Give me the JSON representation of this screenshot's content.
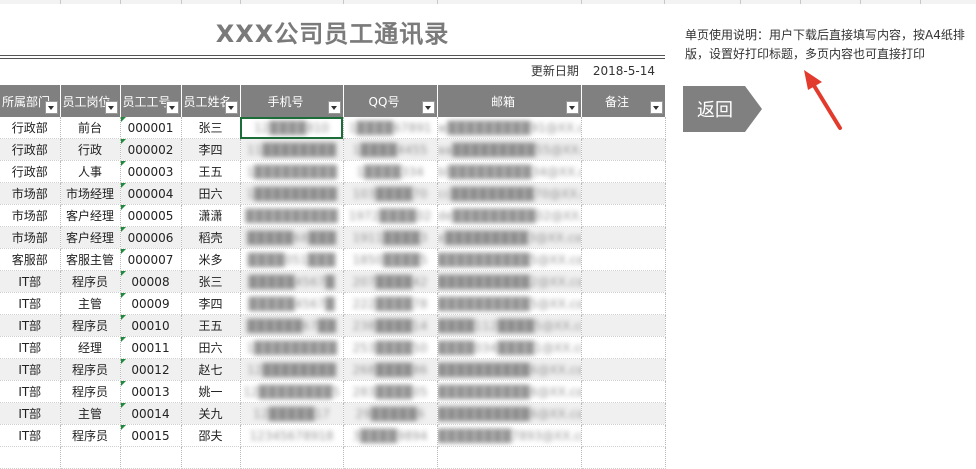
{
  "title": "XXX公司员工通讯录",
  "update_label": "更新日期",
  "update_date": "2018-5-14",
  "usage_note": "单页使用说明：用户下载后直接填写内容，按A4纸排版，设置好打印标题，多页内容也可直接打印",
  "back_button": "返回",
  "headers": [
    "所属部门",
    "员工岗位",
    "员工工号",
    "员工姓名",
    "手机号",
    "QQ号",
    "邮箱",
    "备注"
  ],
  "rows": [
    {
      "dept": "行政部",
      "post": "前台",
      "id": "000001",
      "name": "张三",
      "phone": "12████810",
      "qq": "1████67891",
      "email": "w█████████91@XX.com",
      "note": ""
    },
    {
      "dept": "行政部",
      "post": "行政",
      "id": "000002",
      "name": "李四",
      "phone": "11████████",
      "qq": "1████4455",
      "email": "aa█████████55@XX.com",
      "note": ""
    },
    {
      "dept": "行政部",
      "post": "人事",
      "id": "000003",
      "name": "王五",
      "phone": "1█████████",
      "qq": "1████334",
      "email": "bl█████████34@XX.com",
      "note": ""
    },
    {
      "dept": "市场部",
      "post": "市场经理",
      "id": "000004",
      "name": "田六",
      "phone": "1█████████",
      "qq": "103████70",
      "email": "cc█████████70@XX.com",
      "note": ""
    },
    {
      "dept": "市场部",
      "post": "客户经理",
      "id": "000005",
      "name": "潇潇",
      "phone": "██████████",
      "qq": "1972████02",
      "email": "de█████████02@XX.com",
      "note": ""
    },
    {
      "dept": "市场部",
      "post": "客户经理",
      "id": "000006",
      "name": "稻壳",
      "phone": "█████68███",
      "qq": "1911████3",
      "email": "e█████████3@XX.com",
      "note": ""
    },
    {
      "dept": "客服部",
      "post": "客服主管",
      "id": "000007",
      "name": "米多",
      "phone": "████051███",
      "qq": "1850████5",
      "email": "██████████5@XX.com",
      "note": ""
    },
    {
      "dept": "IT部",
      "post": "程序员",
      "id": "00008",
      "name": "张三",
      "phone": "█████4567█",
      "qq": "207████42",
      "email": "██████████2@XX.com",
      "note": ""
    },
    {
      "dept": "IT部",
      "post": "主管",
      "id": "00009",
      "name": "李四",
      "phone": "█████4567█",
      "qq": "222████78",
      "email": "██████████5@XX.com",
      "note": ""
    },
    {
      "dept": "IT部",
      "post": "程序员",
      "id": "00010",
      "name": "王五",
      "phone": "██████67██",
      "qq": "238████14",
      "email": "████112████5@XX.com",
      "note": ""
    },
    {
      "dept": "IT部",
      "post": "经理",
      "id": "00011",
      "name": "田六",
      "phone": "1█████████",
      "qq": "253████50",
      "email": "████034████1@XX.com",
      "note": ""
    },
    {
      "dept": "IT部",
      "post": "程序员",
      "id": "00012",
      "name": "赵七",
      "phone": "12████████",
      "qq": "268████86",
      "email": "██████████6@XX.com",
      "note": ""
    },
    {
      "dept": "IT部",
      "post": "程序员",
      "id": "00013",
      "name": "姚一",
      "phone": "12████████5",
      "qq": "283████05",
      "email": "██████████6@XX.com",
      "note": ""
    },
    {
      "dept": "IT部",
      "post": "主管",
      "id": "00014",
      "name": "关九",
      "phone": "12█████17",
      "qq": "29█████6",
      "email": "██████████6@XX.com",
      "note": ""
    },
    {
      "dept": "IT部",
      "post": "程序员",
      "id": "00015",
      "name": "邵夫",
      "phone": "12345678918",
      "qq": "3████9894",
      "email": "████████7893@XX.com",
      "note": ""
    }
  ]
}
